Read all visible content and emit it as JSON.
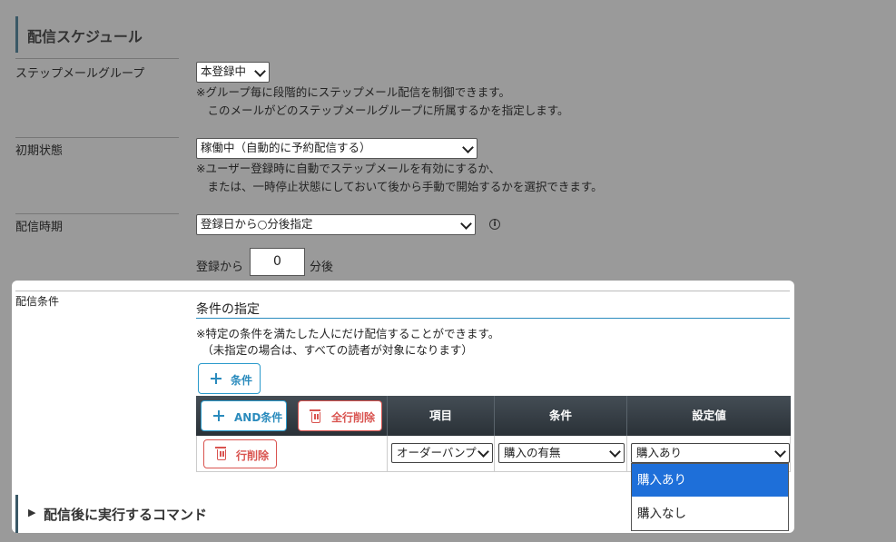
{
  "section_title": "配信スケジュール",
  "step_group": {
    "label": "ステップメールグループ",
    "value": "本登録中",
    "notes": [
      "※グループ毎に段階的にステップメール配信を制御できます。",
      "　このメールがどのステップメールグループに所属するかを指定します。"
    ]
  },
  "initial_state": {
    "label": "初期状態",
    "value": "稼働中（自動的に予約配信する）",
    "notes": [
      "※ユーザー登録時に自動でステップメールを有効にするか、",
      "　または、一時停止状態にしておいて後から手動で開始するかを選択できます。"
    ]
  },
  "timing": {
    "label": "配信時期",
    "value": "登録日から○分後指定",
    "info_icon": "i",
    "prefix": "登録から",
    "minutes": "0",
    "suffix": "分後"
  },
  "conditions": {
    "label": "配信条件",
    "heading": "条件の指定",
    "notes": [
      "※特定の条件を満たした人にだけ配信することができます。",
      "　（未指定の場合は、すべての読者が対象になります）"
    ],
    "add_button": "条件",
    "and_button": "AND条件",
    "delete_all_button": "全行削除",
    "columns": [
      "項目",
      "条件",
      "設定値"
    ],
    "row": {
      "delete_button": "行削除",
      "item": "オーダーバンプ",
      "condition": "購入の有無",
      "value": "購入あり"
    },
    "dropdown_options": [
      "購入あり",
      "購入なし"
    ]
  },
  "command_section": {
    "arrow": "▶",
    "title": "配信後に実行するコマンド"
  },
  "colors": {
    "accent": "#2a8bbd",
    "danger": "#d9534f",
    "header": "#2f373d",
    "highlight": "#1e6fd9"
  }
}
